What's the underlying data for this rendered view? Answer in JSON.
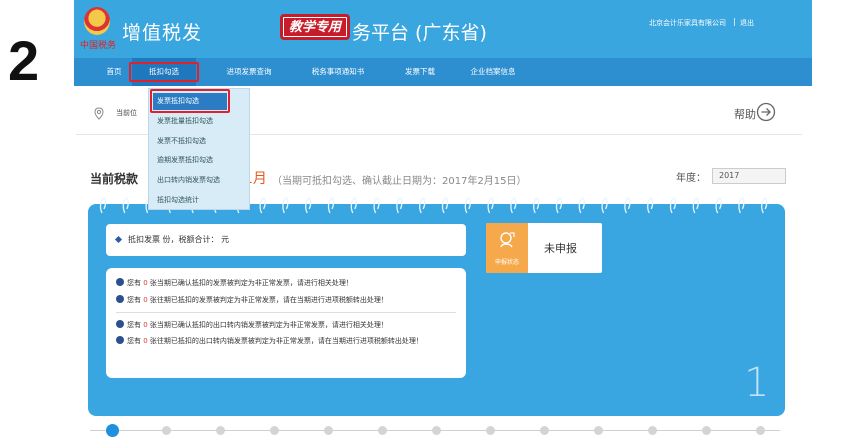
{
  "step_number": "2",
  "header": {
    "logo_caption": "中国税务",
    "title_left": "增值税发",
    "badge": "教学专用",
    "title_right": "务平台 (广东省)",
    "company": "北京会计乐家具有限公司",
    "separator": "|",
    "logout": "退出"
  },
  "nav": {
    "items": [
      {
        "label": "首页"
      },
      {
        "label": "抵扣勾选"
      },
      {
        "label": "进项发票查询"
      },
      {
        "label": "税务事项通知书"
      },
      {
        "label": "发票下载"
      },
      {
        "label": "企业档案信息"
      }
    ]
  },
  "dropdown": {
    "items": [
      {
        "label": "发票抵扣勾选"
      },
      {
        "label": "发票批量抵扣勾选"
      },
      {
        "label": "发票不抵扣勾选"
      },
      {
        "label": "逾期发票抵扣勾选"
      },
      {
        "label": "出口转内销发票勾选"
      },
      {
        "label": "抵扣勾选统计"
      }
    ]
  },
  "breadcrumb": {
    "text": "当前位"
  },
  "help": {
    "label": "帮助"
  },
  "period": {
    "title": "当前税款",
    "month": "1月",
    "note": "（当期可抵扣勾选、确认截止日期为：2017年2月15日）",
    "year_label": "年度：",
    "year_value": "2017"
  },
  "card": {
    "summary": "抵扣发票  份，税额合计：  元",
    "status_label": "申报状态",
    "status_value": "未申报",
    "notices": [
      {
        "pre": "您有 ",
        "zero": "0",
        "post": " 张当期已确认抵扣的发票被判定为非正常发票，请进行相关处理！"
      },
      {
        "pre": "您有 ",
        "zero": "0",
        "post": " 张往期已抵扣的发票被判定为非正常发票，请在当期进行进项税额转出处理！"
      },
      {
        "pre": "您有 ",
        "zero": "0",
        "post": " 张当期已确认抵扣的出口转内销发票被判定为非正常发票，请进行相关处理！"
      },
      {
        "pre": "您有 ",
        "zero": "0",
        "post": " 张往期已抵扣的出口转内销发票被判定为非正常发票，请在当期进行进项税额转出处理！"
      }
    ],
    "page_number": "1"
  },
  "pager": {
    "count": 13,
    "active_index": 0
  },
  "colors": {
    "header_blue": "#3aa6df",
    "nav_blue": "#2d8fd0",
    "card_blue": "#39a6e2",
    "highlight_red": "#e1202c",
    "status_orange": "#f6a94a",
    "month_orange": "#e65a1e"
  }
}
